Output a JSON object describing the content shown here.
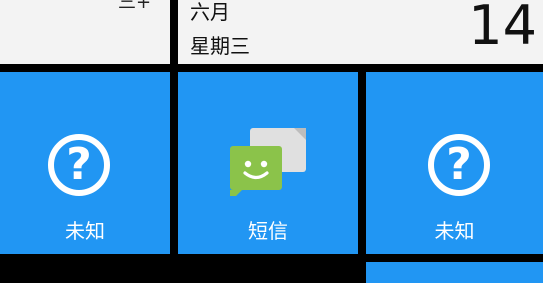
{
  "top_left_tile": {
    "fragment": "三+"
  },
  "date_tile": {
    "month": "六月",
    "weekday": "星期三",
    "day": "14"
  },
  "tiles": [
    {
      "label": "未知",
      "icon": "question-mark-icon"
    },
    {
      "label": "短信",
      "icon": "sms-app-icon"
    },
    {
      "label": "未知",
      "icon": "question-mark-icon"
    }
  ],
  "colors": {
    "tile_blue": "#2196f3",
    "tile_gray": "#f3f3f3",
    "background": "#000000",
    "sms_green": "#8bc34a"
  }
}
